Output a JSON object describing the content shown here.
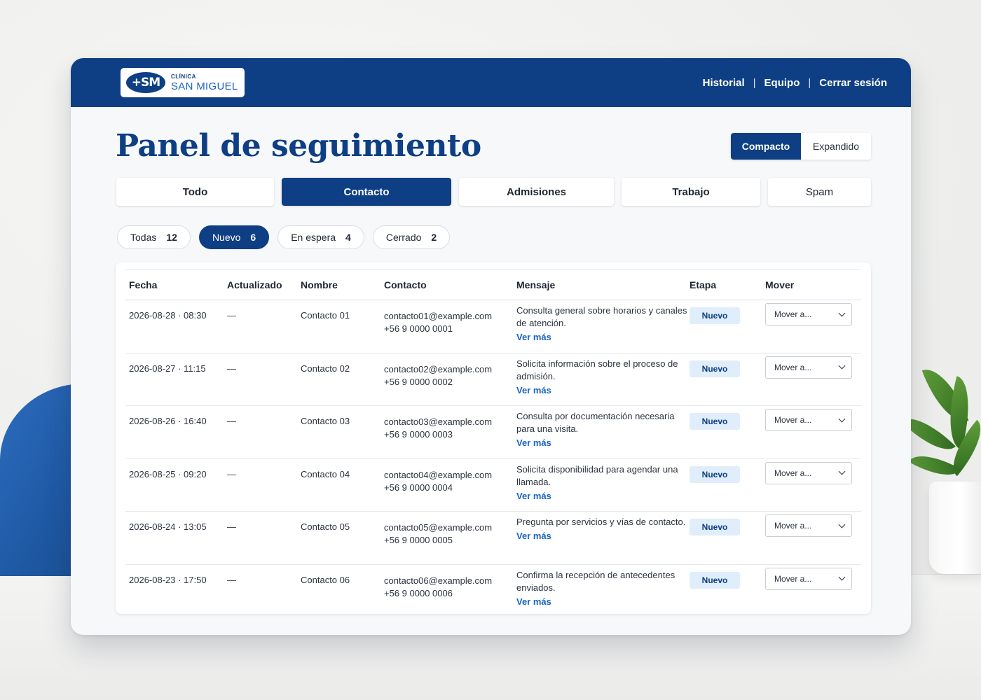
{
  "header": {
    "logo_mark": "+SM",
    "logo_sub": "CLÍNICA",
    "logo_main": "SAN MIGUEL",
    "nav": [
      "Historial",
      "Equipo",
      "Cerrar sesión"
    ],
    "separator": "|"
  },
  "page": {
    "title": "Panel de seguimiento",
    "view_toggle": {
      "compact": "Compacto",
      "expanded": "Expandido",
      "selected": "Compacto"
    }
  },
  "tabs": [
    {
      "label": "Todo",
      "active": false
    },
    {
      "label": "Contacto",
      "active": true
    },
    {
      "label": "Admisiones",
      "active": false
    },
    {
      "label": "Trabajo",
      "active": false
    },
    {
      "label": "Spam",
      "active": false
    }
  ],
  "filters": [
    {
      "label": "Todas",
      "count": "12",
      "active": false
    },
    {
      "label": "Nuevo",
      "count": "6",
      "active": true
    },
    {
      "label": "En espera",
      "count": "4",
      "active": false
    },
    {
      "label": "Cerrado",
      "count": "2",
      "active": false
    }
  ],
  "table": {
    "columns": [
      "Fecha",
      "Actualizado",
      "Nombre",
      "Contacto",
      "Mensaje",
      "Etapa",
      "Mover"
    ],
    "rows": [
      {
        "fecha": "2026-08-28 · 08:30",
        "actualizado": "—",
        "nombre": "Contacto 01",
        "email": "contacto01@example.com",
        "phone": "+56 9 0000 0001",
        "mensaje": "Consulta general sobre horarios y canales de atención.",
        "ver_mas": "Ver más",
        "etapa": "Nuevo",
        "mover": "Mover a..."
      },
      {
        "fecha": "2026-08-27 · 11:15",
        "actualizado": "—",
        "nombre": "Contacto 02",
        "email": "contacto02@example.com",
        "phone": "+56 9 0000 0002",
        "mensaje": "Solicita información sobre el proceso de admisión.",
        "ver_mas": "Ver más",
        "etapa": "Nuevo",
        "mover": "Mover a..."
      },
      {
        "fecha": "2026-08-26 · 16:40",
        "actualizado": "—",
        "nombre": "Contacto 03",
        "email": "contacto03@example.com",
        "phone": "+56 9 0000 0003",
        "mensaje": "Consulta por documentación necesaria para una visita.",
        "ver_mas": "Ver más",
        "etapa": "Nuevo",
        "mover": "Mover a..."
      },
      {
        "fecha": "2026-08-25 · 09:20",
        "actualizado": "—",
        "nombre": "Contacto 04",
        "email": "contacto04@example.com",
        "phone": "+56 9 0000 0004",
        "mensaje": "Solicita disponibilidad para agendar una llamada.",
        "ver_mas": "Ver más",
        "etapa": "Nuevo",
        "mover": "Mover a..."
      },
      {
        "fecha": "2026-08-24 · 13:05",
        "actualizado": "—",
        "nombre": "Contacto 05",
        "email": "contacto05@example.com",
        "phone": "+56 9 0000 0005",
        "mensaje": "Pregunta por servicios y vías de contacto.",
        "ver_mas": "Ver más",
        "etapa": "Nuevo",
        "mover": "Mover a..."
      },
      {
        "fecha": "2026-08-23 · 17:50",
        "actualizado": "—",
        "nombre": "Contacto 06",
        "email": "contacto06@example.com",
        "phone": "+56 9 0000 0006",
        "mensaje": "Confirma la recepción de antecedentes enviados.",
        "ver_mas": "Ver más",
        "etapa": "Nuevo",
        "mover": "Mover a..."
      }
    ]
  },
  "colors": {
    "brand": "#0e3f84",
    "link": "#1a64c0",
    "badge_bg": "#dfeefa"
  }
}
